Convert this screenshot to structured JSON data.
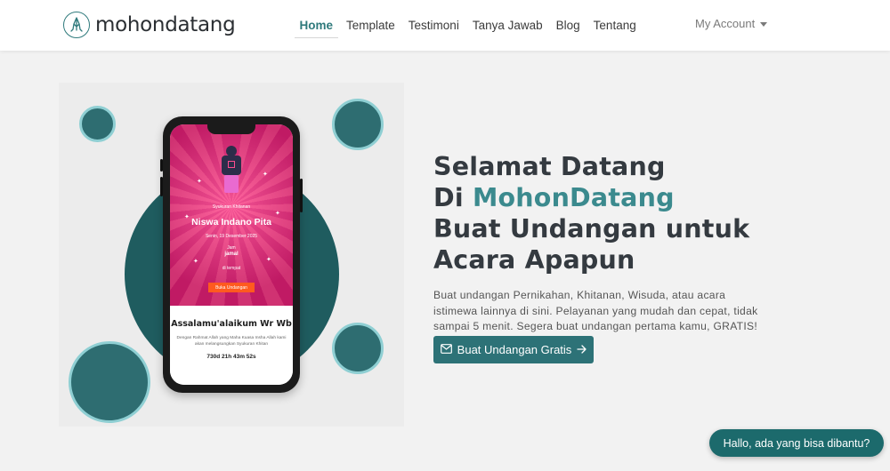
{
  "brand": {
    "name": "mohondatang",
    "logo_icon": "praying-hands-icon",
    "accent_color": "#2f7a7c"
  },
  "nav": {
    "items": [
      {
        "label": "Home",
        "active": true
      },
      {
        "label": "Template",
        "active": false
      },
      {
        "label": "Testimoni",
        "active": false
      },
      {
        "label": "Tanya Jawab",
        "active": false
      },
      {
        "label": "Blog",
        "active": false
      },
      {
        "label": "Tentang",
        "active": false
      }
    ],
    "account_label": "My Account"
  },
  "phone_preview": {
    "event_type": "Syukuran Khitanan",
    "child_name": "Niswa Indano Pita",
    "date": "Senin, 19 Desember 2025",
    "time_label": "Jam",
    "time_value": "jamal",
    "place": "di tempat",
    "button_label": "Buka Undangan",
    "greeting": "Assalamu'alaikum Wr Wb",
    "intro": "Dengan Rahmat Allah yang Maha Kuasa Insha Allah kami akan melangsungkan Syukuran Khitan",
    "countdown": "730d 21h 43m 52s"
  },
  "hero": {
    "line1": "Selamat Datang",
    "line2_prefix": "Di",
    "line2_accent": "MohonDatang",
    "line3": "Buat Undangan untuk",
    "line4": "Acara Apapun",
    "description": "Buat undangan Pernikahan, Khitanan, Wisuda, atau acara istimewa lainnya di sini. Pelayanan yang mudah dan cepat, tidak sampai 5 menit. Segera buat undangan pertama kamu, GRATIS!",
    "cta_label": "Buat Undangan Gratis",
    "cta_icon": "envelope-icon",
    "cta_arrow_icon": "arrow-right-icon"
  },
  "chat": {
    "label": "Hallo, ada yang bisa dibantu?"
  },
  "colors": {
    "primary": "#2d7277",
    "accent_text": "#3b8a8e",
    "dark_circle": "#1f5c5f",
    "ring": "#8fcfd3"
  }
}
